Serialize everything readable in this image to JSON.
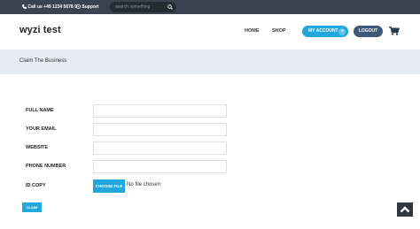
{
  "topbar": {
    "phone_icon": "phone-icon",
    "phone": "Call us +49 1234 5678 9",
    "support_icon": "support-icon",
    "support": "Support",
    "search_placeholder": "search something"
  },
  "header": {
    "logo": "wyzi test",
    "nav": [
      "HOME",
      "SHOP"
    ],
    "account_label": "MY ACCOUNT",
    "logout_label": "LOGOUT",
    "cart_count": "1"
  },
  "page": {
    "title": "Claim The Business"
  },
  "form": {
    "fields": [
      {
        "label": "FULL NAME",
        "value": ""
      },
      {
        "label": "YOUR EMAIL",
        "value": ""
      },
      {
        "label": "WEBSITE",
        "value": ""
      },
      {
        "label": "PHONE NUMBER",
        "value": ""
      }
    ],
    "id_copy_label": "ID COPY",
    "file_button": "CHOOSE FILE",
    "file_status": "No file chosen",
    "submit": "CLAIM"
  },
  "colors": {
    "topbar": "#3a4350",
    "accent": "#22a7dd",
    "logout": "#3f5a78",
    "title_bg": "#e5ecf3"
  }
}
